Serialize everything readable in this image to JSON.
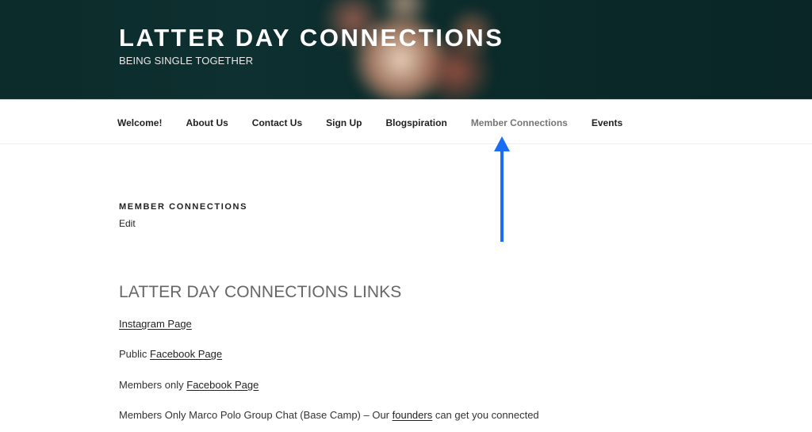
{
  "header": {
    "site_title": "LATTER DAY CONNECTIONS",
    "site_description": "BEING SINGLE TOGETHER"
  },
  "nav": {
    "items": [
      {
        "label": "Welcome!",
        "current": false
      },
      {
        "label": "About Us",
        "current": false
      },
      {
        "label": "Contact Us",
        "current": false
      },
      {
        "label": "Sign Up",
        "current": false
      },
      {
        "label": "Blogspiration",
        "current": false
      },
      {
        "label": "Member Connections",
        "current": true
      },
      {
        "label": "Events",
        "current": false
      }
    ]
  },
  "page": {
    "title": "MEMBER CONNECTIONS",
    "edit_label": "Edit",
    "section_heading": "LATTER DAY CONNECTIONS LINKS",
    "paragraphs": [
      {
        "prefix": "",
        "link": "Instagram Page",
        "suffix": ""
      },
      {
        "prefix": "Public ",
        "link": "Facebook Page",
        "suffix": ""
      },
      {
        "prefix": "Members only ",
        "link": "Facebook Page",
        "suffix": ""
      },
      {
        "prefix": "Members Only Marco Polo Group Chat (Base Camp) – Our ",
        "link": "founders",
        "suffix": " can get you connected"
      }
    ]
  },
  "annotation": {
    "type": "arrow-pointing-up",
    "color": "#1a6ef5",
    "target": "Member Connections"
  }
}
